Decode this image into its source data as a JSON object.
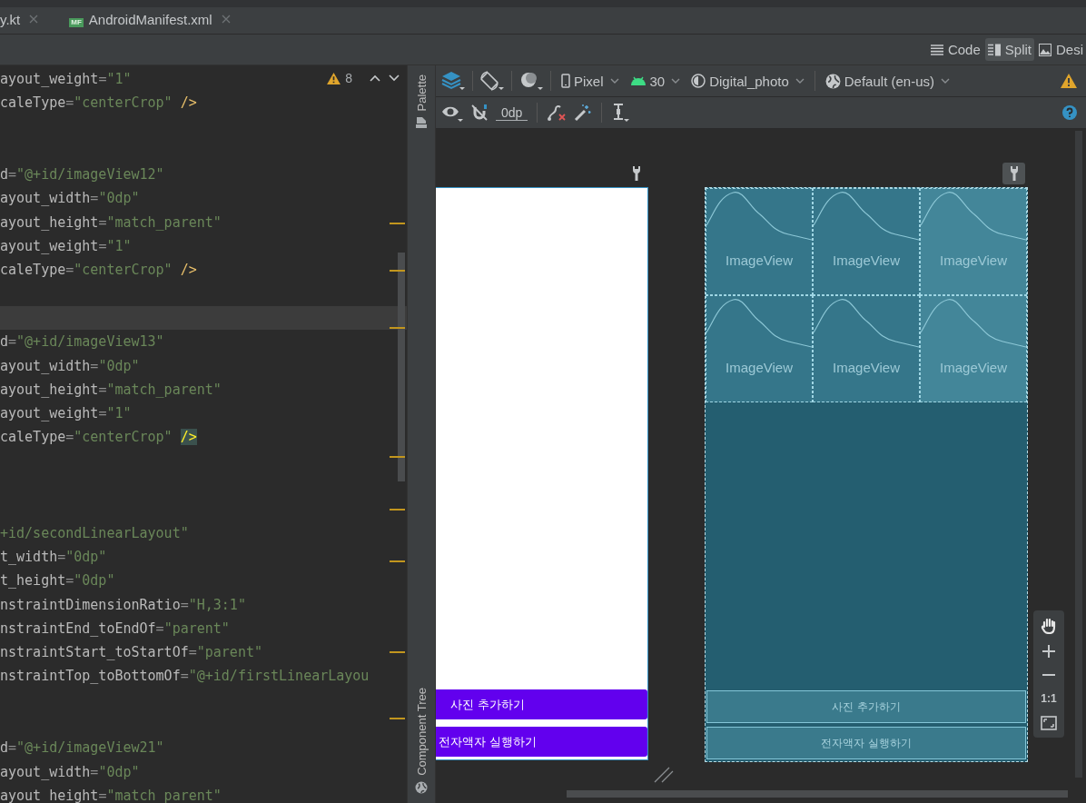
{
  "file_tabs": [
    {
      "label": "y.kt",
      "selected": false
    },
    {
      "label": "AndroidManifest.xml",
      "icon_label": "MF",
      "selected": false
    }
  ],
  "view_modes": [
    {
      "label": "Code",
      "selected": false
    },
    {
      "label": "Split",
      "selected": true
    },
    {
      "label": "Desi",
      "selected": false
    }
  ],
  "editor": {
    "problems": "8",
    "lines": [
      {
        "current": false,
        "segments": [
          {
            "kind": "attr",
            "text": "ayout_weight"
          },
          {
            "kind": "punct",
            "text": "="
          },
          {
            "kind": "string",
            "text": "\"1\""
          }
        ]
      },
      {
        "current": false,
        "segments": [
          {
            "kind": "attr",
            "text": "caleType"
          },
          {
            "kind": "punct",
            "text": "="
          },
          {
            "kind": "string",
            "text": "\"centerCrop\" "
          },
          {
            "kind": "tag",
            "text": "/>"
          }
        ]
      },
      {
        "current": false
      },
      {
        "current": false
      },
      {
        "current": false,
        "segments": [
          {
            "kind": "attr",
            "text": "d"
          },
          {
            "kind": "punct",
            "text": "="
          },
          {
            "kind": "string",
            "text": "\"@+id/imageView12\""
          }
        ]
      },
      {
        "current": false,
        "segments": [
          {
            "kind": "attr",
            "text": "ayout_width"
          },
          {
            "kind": "punct",
            "text": "="
          },
          {
            "kind": "string",
            "text": "\"0dp\""
          }
        ]
      },
      {
        "current": false,
        "segments": [
          {
            "kind": "attr",
            "text": "ayout_height"
          },
          {
            "kind": "punct",
            "text": "="
          },
          {
            "kind": "string",
            "text": "\"match_parent\""
          }
        ]
      },
      {
        "current": false,
        "segments": [
          {
            "kind": "attr",
            "text": "ayout_weight"
          },
          {
            "kind": "punct",
            "text": "="
          },
          {
            "kind": "string",
            "text": "\"1\""
          }
        ]
      },
      {
        "current": false,
        "segments": [
          {
            "kind": "attr",
            "text": "caleType"
          },
          {
            "kind": "punct",
            "text": "="
          },
          {
            "kind": "string",
            "text": "\"centerCrop\" "
          },
          {
            "kind": "tag",
            "text": "/>"
          }
        ]
      },
      {
        "current": false
      },
      {
        "current": true
      },
      {
        "current": false,
        "segments": [
          {
            "kind": "attr",
            "text": "d"
          },
          {
            "kind": "punct",
            "text": "="
          },
          {
            "kind": "string",
            "text": "\"@+id/imageView13\""
          }
        ]
      },
      {
        "current": false,
        "segments": [
          {
            "kind": "attr",
            "text": "ayout_width"
          },
          {
            "kind": "punct",
            "text": "="
          },
          {
            "kind": "string",
            "text": "\"0dp\""
          }
        ]
      },
      {
        "current": false,
        "segments": [
          {
            "kind": "attr",
            "text": "ayout_height"
          },
          {
            "kind": "punct",
            "text": "="
          },
          {
            "kind": "string",
            "text": "\"match_parent\""
          }
        ]
      },
      {
        "current": false,
        "segments": [
          {
            "kind": "attr",
            "text": "ayout_weight"
          },
          {
            "kind": "punct",
            "text": "="
          },
          {
            "kind": "string",
            "text": "\"1\""
          }
        ]
      },
      {
        "current": false,
        "segments": [
          {
            "kind": "attr",
            "text": "caleType"
          },
          {
            "kind": "punct",
            "text": "="
          },
          {
            "kind": "string",
            "text": "\"centerCrop\" "
          },
          {
            "kind": "tag_match",
            "text": "/>"
          }
        ]
      },
      {
        "current": false
      },
      {
        "current": false
      },
      {
        "current": false
      },
      {
        "current": false,
        "segments": [
          {
            "kind": "string",
            "text": "+id/secondLinearLayout\""
          }
        ]
      },
      {
        "current": false,
        "segments": [
          {
            "kind": "attr",
            "text": "t_width"
          },
          {
            "kind": "punct",
            "text": "="
          },
          {
            "kind": "string",
            "text": "\"0dp\""
          }
        ]
      },
      {
        "current": false,
        "segments": [
          {
            "kind": "attr",
            "text": "t_height"
          },
          {
            "kind": "punct",
            "text": "="
          },
          {
            "kind": "string",
            "text": "\"0dp\""
          }
        ]
      },
      {
        "current": false,
        "segments": [
          {
            "kind": "attr",
            "text": "nstraintDimensionRatio"
          },
          {
            "kind": "punct",
            "text": "="
          },
          {
            "kind": "string",
            "text": "\"H,3:1\""
          }
        ]
      },
      {
        "current": false,
        "segments": [
          {
            "kind": "attr",
            "text": "nstraintEnd_toEndOf"
          },
          {
            "kind": "punct",
            "text": "="
          },
          {
            "kind": "string",
            "text": "\"parent\""
          }
        ]
      },
      {
        "current": false,
        "segments": [
          {
            "kind": "attr",
            "text": "nstraintStart_toStartOf"
          },
          {
            "kind": "punct",
            "text": "="
          },
          {
            "kind": "string",
            "text": "\"parent\""
          }
        ]
      },
      {
        "current": false,
        "segments": [
          {
            "kind": "attr",
            "text": "nstraintTop_toBottomOf"
          },
          {
            "kind": "punct",
            "text": "="
          },
          {
            "kind": "string",
            "text": "\"@+id/firstLinearLayou"
          }
        ]
      },
      {
        "current": false
      },
      {
        "current": false
      },
      {
        "current": false,
        "segments": [
          {
            "kind": "attr",
            "text": "d"
          },
          {
            "kind": "punct",
            "text": "="
          },
          {
            "kind": "string",
            "text": "\"@+id/imageView21\""
          }
        ]
      },
      {
        "current": false,
        "segments": [
          {
            "kind": "attr",
            "text": "ayout_width"
          },
          {
            "kind": "punct",
            "text": "="
          },
          {
            "kind": "string",
            "text": "\"0dp\""
          }
        ]
      },
      {
        "current": false,
        "segments": [
          {
            "kind": "attr",
            "text": "ayout_height"
          },
          {
            "kind": "punct",
            "text": "="
          },
          {
            "kind": "string",
            "text": "\"match_parent\""
          }
        ]
      }
    ]
  },
  "side_panels": [
    "Palette",
    "Component Tree"
  ],
  "design_toolbar": {
    "device": "Pixel",
    "api": "30",
    "theme": "Digital_photo",
    "locale": "Default (en-us)",
    "margin": "0dp"
  },
  "design_preview": {
    "buttons": [
      "사진 추가하기",
      "전자액자 실행하기"
    ]
  },
  "blueprint": {
    "image_views": [
      "ImageView",
      "ImageView",
      "ImageView",
      "ImageView",
      "ImageView",
      "ImageView"
    ],
    "buttons": [
      "사진 추가하기",
      "전자액자 실행하기"
    ]
  },
  "zoom_controls": {
    "actual_size": "1:1"
  }
}
